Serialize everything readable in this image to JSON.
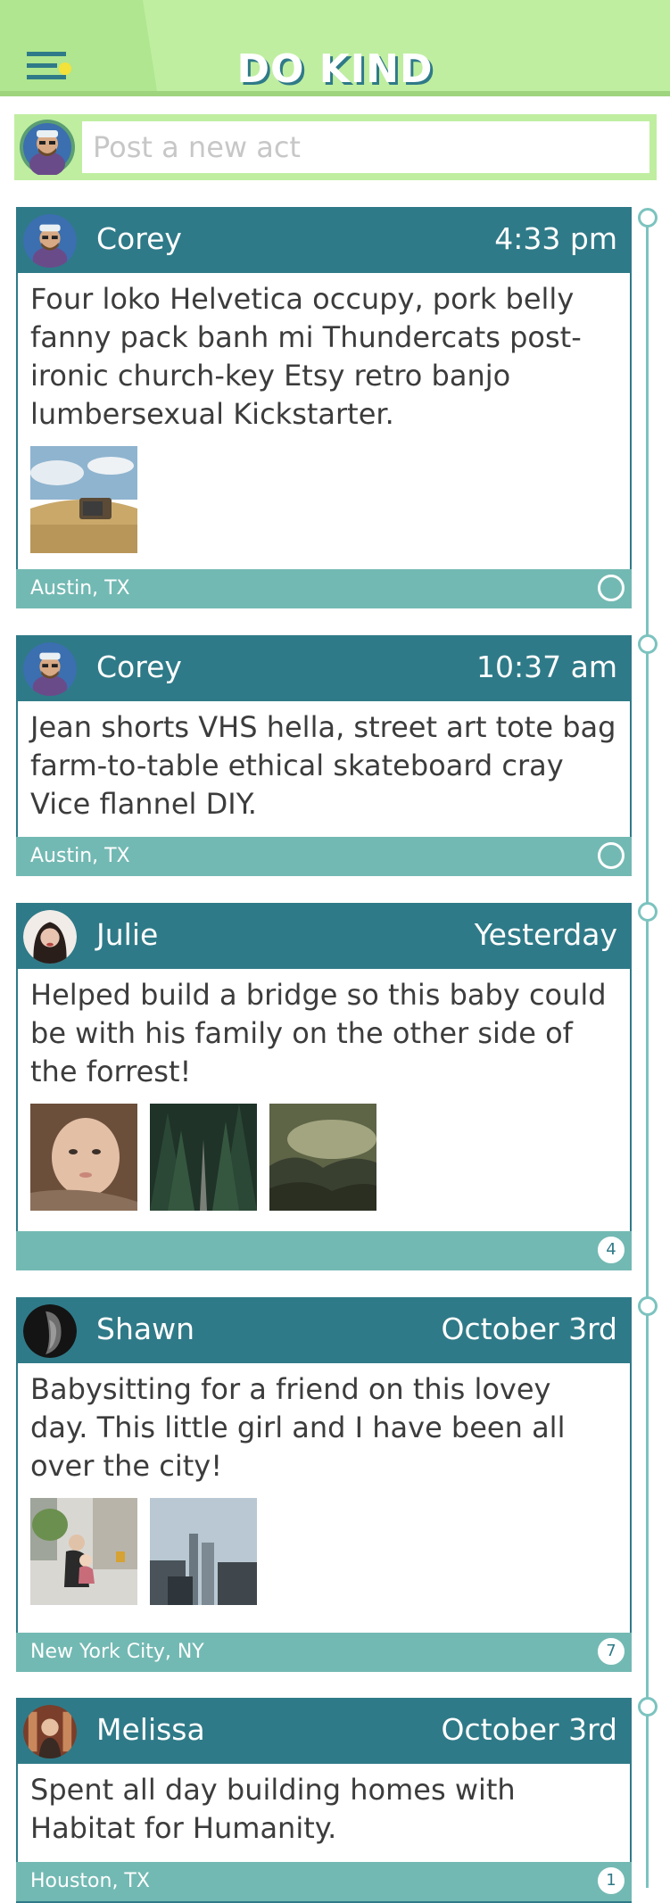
{
  "app": {
    "title": "DO KIND"
  },
  "composer": {
    "placeholder": "Post a new act"
  },
  "icons": {
    "menu": "menu-icon",
    "badge_empty": "circle-icon"
  },
  "colors": {
    "header": "#bfeea0",
    "primary": "#2f7a88",
    "footer": "#73b9b3",
    "accent": "#f3e23a"
  },
  "posts": [
    {
      "user": "Corey",
      "time": "4:33 pm",
      "text": "Four loko Helvetica occupy, pork belly fanny pack banh mi Thundercats post-ironic church-key Etsy retro banjo lumbersexual Kickstarter.",
      "location": "Austin, TX",
      "count": ""
    },
    {
      "user": "Corey",
      "time": "10:37 am",
      "text": "Jean shorts VHS hella, street art tote bag farm-to-table ethical skateboard cray Vice flannel DIY.",
      "location": "Austin, TX",
      "count": ""
    },
    {
      "user": "Julie",
      "time": "Yesterday",
      "text": "Helped build a bridge so this baby could be with his family on the other side of the forrest!",
      "location": "",
      "count": "4"
    },
    {
      "user": "Shawn",
      "time": "October 3rd",
      "text": "Babysitting for a friend on this lovey day. This little girl and I have been all over the city!",
      "location": "New York City, NY",
      "count": "7"
    },
    {
      "user": "Melissa",
      "time": "October 3rd",
      "text": "Spent all day building homes with Habitat for Humanity.",
      "location": "Houston, TX",
      "count": "1"
    }
  ]
}
